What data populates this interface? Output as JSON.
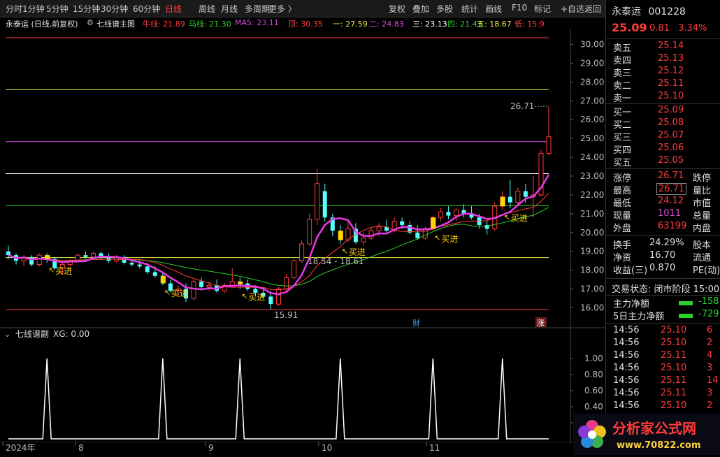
{
  "toolbar": {
    "left_items": [
      "分时",
      "1分钟",
      "5分钟",
      "15分钟",
      "30分钟",
      "60分钟",
      "日线",
      "周线",
      "月线",
      "多周期",
      "更多 〉"
    ],
    "active": "日线",
    "right_items": [
      "复权",
      "叠加",
      "多股",
      "统计",
      "画线",
      "F10",
      "标记",
      "+自选",
      "返回"
    ]
  },
  "legend": {
    "stock": "永泰运 (日线,前复权)",
    "indicator": "七线谱主图",
    "items": [
      {
        "label": "牛线: 21.89",
        "color": "#ff3b3b"
      },
      {
        "label": "马线: 21.30",
        "color": "#2bd12b"
      },
      {
        "label": "MA5: 23.11",
        "color": "#d44cd4"
      },
      {
        "label": "顶: 30.35",
        "color": "#ff3b3b"
      },
      {
        "label": "一: 27.59",
        "color": "#e8e84a"
      },
      {
        "label": "二: 24.83",
        "color": "#d44cd4"
      },
      {
        "label": "三: 23.13",
        "color": "#ffffff"
      },
      {
        "label": "四: 21.43",
        "color": "#2bd12b"
      },
      {
        "label": "五: 18.67",
        "color": "#e8e84a"
      },
      {
        "label": "低: 15.9",
        "color": "#ff3b3b"
      }
    ]
  },
  "main_chart": {
    "yaxis_ticks": [
      "30.00",
      "29.00",
      "28.00",
      "27.00",
      "26.00",
      "25.00",
      "24.00",
      "23.00",
      "22.00",
      "21.00",
      "20.00",
      "19.00",
      "18.00",
      "17.00",
      "16.00"
    ],
    "annotations": {
      "high": "26.71",
      "low": "15.91",
      "range": "18.54 - 18.61"
    },
    "signal_label": "买进",
    "marker_cai": "财",
    "marker_zhang": "涨"
  },
  "sub_chart": {
    "title": "七线谱副",
    "xg": "XG: 0.00",
    "yaxis_ticks": [
      "1.00",
      "0.80",
      "0.60",
      "0.40",
      "0.20"
    ]
  },
  "xaxis": [
    "2024年",
    "8",
    "9",
    "10",
    "11"
  ],
  "chart_data": {
    "type": "line",
    "title": "永泰运 (日线,前复权)",
    "horizontal_levels": {
      "顶": 30.35,
      "一": 27.59,
      "二": 24.83,
      "三": 23.13,
      "四": 21.43,
      "五": 18.67,
      "低": 15.9
    },
    "ylim": [
      15.5,
      30.5
    ],
    "candles": [
      [
        19.0,
        19.3,
        18.6,
        18.8
      ],
      [
        18.8,
        18.9,
        18.3,
        18.5
      ],
      [
        18.5,
        18.8,
        18.2,
        18.7
      ],
      [
        18.7,
        18.8,
        18.2,
        18.3
      ],
      [
        18.3,
        18.9,
        18.2,
        18.8
      ],
      [
        18.8,
        18.9,
        18.4,
        18.6
      ],
      [
        18.6,
        18.7,
        18.0,
        18.1
      ],
      [
        18.1,
        18.4,
        17.8,
        18.3
      ],
      [
        18.3,
        18.6,
        18.2,
        18.5
      ],
      [
        18.5,
        18.9,
        18.4,
        18.8
      ],
      [
        18.8,
        19.0,
        18.6,
        18.7
      ],
      [
        18.7,
        19.0,
        18.6,
        18.9
      ],
      [
        18.9,
        19.0,
        18.6,
        18.7
      ],
      [
        18.7,
        18.9,
        18.4,
        18.5
      ],
      [
        18.5,
        18.8,
        18.4,
        18.7
      ],
      [
        18.7,
        18.8,
        18.3,
        18.4
      ],
      [
        18.4,
        18.6,
        18.2,
        18.3
      ],
      [
        18.3,
        18.5,
        18.1,
        18.2
      ],
      [
        18.2,
        18.4,
        17.8,
        17.9
      ],
      [
        17.9,
        18.2,
        17.6,
        17.7
      ],
      [
        17.7,
        17.9,
        17.2,
        17.3
      ],
      [
        17.3,
        17.5,
        16.8,
        16.9
      ],
      [
        16.9,
        17.2,
        16.6,
        17.0
      ],
      [
        17.0,
        17.3,
        16.3,
        16.5
      ],
      [
        16.5,
        17.5,
        16.4,
        17.4
      ],
      [
        17.4,
        17.6,
        17.0,
        17.1
      ],
      [
        17.1,
        17.4,
        16.9,
        17.2
      ],
      [
        17.2,
        17.5,
        16.8,
        16.9
      ],
      [
        16.9,
        17.3,
        16.8,
        17.2
      ],
      [
        17.2,
        18.1,
        17.1,
        17.4
      ],
      [
        17.4,
        17.6,
        17.0,
        17.3
      ],
      [
        17.3,
        17.5,
        16.9,
        17.0
      ],
      [
        17.0,
        17.2,
        16.6,
        16.8
      ],
      [
        16.8,
        17.0,
        16.5,
        16.6
      ],
      [
        16.6,
        16.9,
        15.9,
        16.2
      ],
      [
        16.2,
        17.1,
        16.1,
        17.0
      ],
      [
        17.0,
        17.8,
        16.9,
        17.6
      ],
      [
        17.6,
        18.6,
        17.5,
        18.5
      ],
      [
        18.5,
        19.6,
        18.4,
        19.4
      ],
      [
        19.4,
        21.0,
        19.3,
        20.7
      ],
      [
        20.7,
        23.4,
        20.4,
        22.6
      ],
      [
        22.2,
        22.6,
        20.6,
        20.8
      ],
      [
        20.8,
        21.0,
        19.8,
        20.1
      ],
      [
        20.1,
        20.4,
        19.4,
        19.6
      ],
      [
        19.6,
        20.6,
        19.5,
        20.2
      ],
      [
        20.2,
        20.5,
        19.4,
        19.5
      ],
      [
        19.5,
        20.0,
        19.3,
        19.7
      ],
      [
        19.7,
        20.3,
        19.6,
        20.1
      ],
      [
        20.1,
        20.5,
        19.8,
        20.3
      ],
      [
        20.3,
        20.7,
        20.0,
        20.1
      ],
      [
        20.1,
        20.8,
        20.0,
        20.6
      ],
      [
        20.6,
        20.8,
        20.2,
        20.4
      ],
      [
        20.4,
        20.6,
        19.9,
        20.0
      ],
      [
        20.0,
        20.4,
        19.6,
        19.7
      ],
      [
        19.7,
        20.3,
        19.6,
        20.2
      ],
      [
        20.2,
        20.9,
        20.1,
        20.8
      ],
      [
        20.8,
        21.3,
        20.6,
        21.1
      ],
      [
        21.1,
        21.4,
        20.7,
        20.9
      ],
      [
        20.9,
        21.3,
        20.6,
        21.2
      ],
      [
        21.2,
        21.5,
        20.8,
        21.0
      ],
      [
        21.0,
        21.4,
        20.7,
        20.8
      ],
      [
        20.8,
        21.0,
        20.2,
        20.4
      ],
      [
        20.4,
        20.6,
        19.9,
        20.2
      ],
      [
        20.2,
        21.6,
        20.1,
        21.4
      ],
      [
        21.4,
        22.2,
        21.2,
        21.9
      ],
      [
        21.9,
        22.8,
        21.3,
        21.6
      ],
      [
        21.6,
        22.4,
        21.4,
        22.2
      ],
      [
        22.2,
        22.6,
        21.6,
        21.9
      ],
      [
        21.9,
        23.0,
        20.8,
        22.0
      ],
      [
        22.0,
        24.4,
        21.9,
        24.2
      ],
      [
        24.2,
        26.71,
        24.12,
        25.09
      ]
    ],
    "buy_signals": [
      5,
      20,
      30,
      43,
      55,
      64
    ],
    "sub_peaks": [
      5,
      20,
      30,
      43,
      55,
      64
    ],
    "sub_ylim": [
      0,
      1.2
    ]
  },
  "quote": {
    "name": "永泰运",
    "code": "001228",
    "price": "25.09",
    "change": "0.81",
    "pct": "3.34%",
    "asks": [
      {
        "label": "卖五",
        "price": "25.14"
      },
      {
        "label": "卖四",
        "price": "25.13"
      },
      {
        "label": "卖三",
        "price": "25.12"
      },
      {
        "label": "卖二",
        "price": "25.11"
      },
      {
        "label": "卖一",
        "price": "25.10"
      }
    ],
    "bids": [
      {
        "label": "买一",
        "price": "25.09"
      },
      {
        "label": "买二",
        "price": "25.08"
      },
      {
        "label": "买三",
        "price": "25.07"
      },
      {
        "label": "买四",
        "price": "25.06"
      },
      {
        "label": "买五",
        "price": "25.05"
      }
    ],
    "stats": [
      {
        "l1": "涨停",
        "v1": "26.71",
        "c1": "red",
        "l2": "跌停"
      },
      {
        "l1": "最高",
        "v1": "26.71",
        "c1": "red",
        "l2": "量比"
      },
      {
        "l1": "最低",
        "v1": "24.12",
        "c1": "red",
        "l2": "市值"
      },
      {
        "l1": "现量",
        "v1": "1011",
        "c1": "purple",
        "l2": "总量"
      },
      {
        "l1": "外盘",
        "v1": "63199",
        "c1": "red",
        "l2": "内盘"
      }
    ],
    "stats2": [
      {
        "l1": "换手",
        "v1": "24.29%",
        "l2": "股本"
      },
      {
        "l1": "净资",
        "v1": "16.70",
        "l2": "流通"
      },
      {
        "l1": "收益(三)",
        "v1": "0.870",
        "l2": "PE(动)"
      }
    ],
    "status": "交易状态: 闭市阶段 15:00",
    "flow": [
      {
        "label": "主力净额",
        "value": "-158"
      },
      {
        "label": "5日主力净额",
        "value": "-729"
      }
    ],
    "ticks": [
      {
        "t": "14:56",
        "p": "25.10",
        "v": "6"
      },
      {
        "t": "14:56",
        "p": "25.10",
        "v": "2"
      },
      {
        "t": "14:56",
        "p": "25.11",
        "v": "4"
      },
      {
        "t": "14:56",
        "p": "25.10",
        "v": "3"
      },
      {
        "t": "14:56",
        "p": "25.11",
        "v": "14"
      },
      {
        "t": "14:56",
        "p": "25.11",
        "v": "3"
      },
      {
        "t": "14:56",
        "p": "25.10",
        "v": "2"
      }
    ]
  },
  "logo": {
    "name": "分析家公式网",
    "url": "www.70822.com"
  }
}
